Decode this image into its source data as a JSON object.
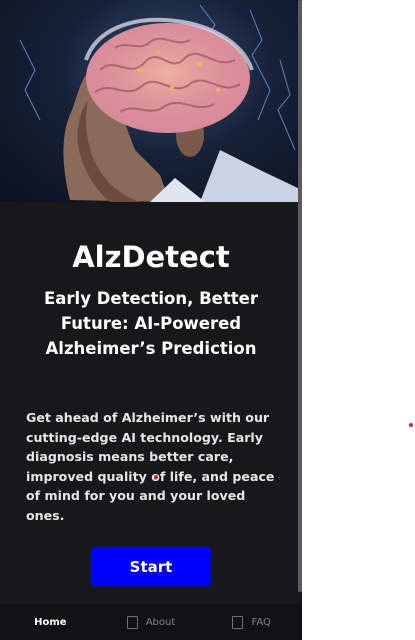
{
  "app": {
    "title": "AlzDetect",
    "subtitle": "Early Detection, Better Future: AI-Powered Alzheimer’s Prediction",
    "description": "Get ahead of Alzheimer’s with our cutting-edge AI technology. Early diagnosis means better care, improved quality of life, and peace of mind for you and your loved ones.",
    "start_label": "Start"
  },
  "hero": {
    "icon": "elderly-man-glowing-brain-illustration"
  },
  "nav": {
    "items": [
      {
        "label": "Home",
        "active": true
      },
      {
        "label": "About",
        "active": false
      },
      {
        "label": "FAQ",
        "active": false
      }
    ]
  },
  "colors": {
    "background": "#17181a",
    "accent": "#0000ff",
    "text": "#ffffff",
    "cursor_dot": "#e0242b"
  }
}
